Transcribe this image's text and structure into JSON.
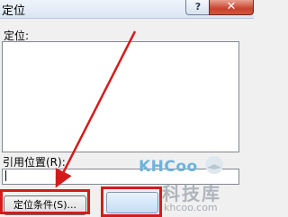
{
  "window": {
    "title": "定位",
    "help_label": "?",
    "close_label": "✕"
  },
  "dialog": {
    "goto_label": "定位:",
    "goto_items": [],
    "reference_label": "引用位置(R):",
    "reference_value": "",
    "special_button_label": "定位条件(S)...",
    "ok_button_label": ""
  },
  "watermark": {
    "brand": "KHCoo",
    "chinese": "科技库",
    "domain": "khcoo.com"
  },
  "annotation": {
    "color": "#d41b1b"
  }
}
